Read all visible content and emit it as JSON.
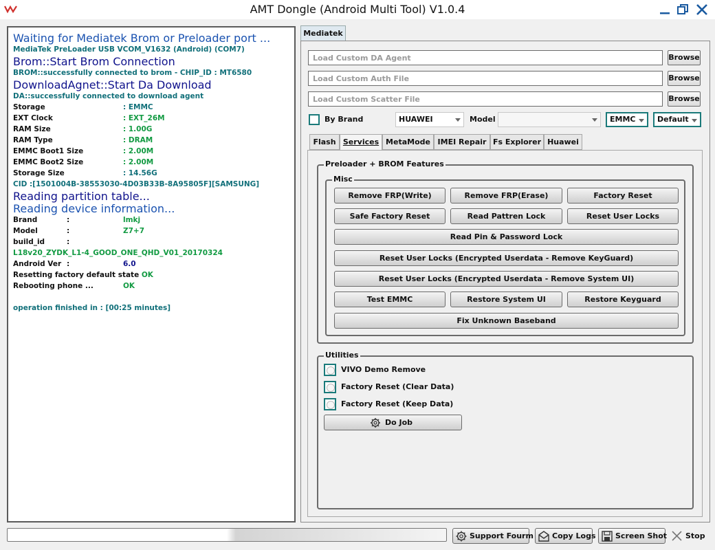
{
  "window": {
    "title": "AMT Dongle (Android Multi Tool) V1.0.4"
  },
  "log": {
    "waiting": "Waiting for Mediatek Brom or Preloader port ...",
    "port": "MediaTek PreLoader USB VCOM_V1632 (Android) (COM7)",
    "brom_start": "Brom::Start Brom Connection",
    "brom_ok": "BROM::successfully connected to brom - CHIP_ID : MT6580",
    "da_start": "DownloadAgnet::Start Da Download",
    "da_ok": "DA::successfully connected to download agent",
    "specs": [
      {
        "key": "Storage",
        "value": ": EMMC"
      },
      {
        "key": "EXT Clock",
        "value": ": EXT_26M"
      },
      {
        "key": "RAM Size",
        "value": ": 1.00G"
      },
      {
        "key": "RAM Type",
        "value": ": DRAM"
      },
      {
        "key": "EMMC Boot1 Size",
        "value": ": 2.00M"
      },
      {
        "key": "EMMC Boot2 Size",
        "value": ": 2.00M"
      },
      {
        "key": "Storage Size",
        "value": ": 14.56G"
      }
    ],
    "cid": "CID :[1501004B-38553030-4D03B33B-8A95805F][SAMSUNG]",
    "reading_partition": "Reading partition table...",
    "reading_device": "Reading device information...",
    "device": {
      "brand_key": "Brand",
      "brand_colon": ":",
      "brand_value": "lmkj",
      "model_key": "Model",
      "model_colon": ":",
      "model_value": "Z7+7",
      "build_key": "build_id",
      "build_colon": ":",
      "build_value": "L18v20_ZYDK_L1-4_GOOD_ONE_QHD_V01_20170324",
      "android_key": "Android Ver",
      "android_colon": ":",
      "android_value": "6.0"
    },
    "reset_label": "Resetting factory default state",
    "reset_status": "OK",
    "reboot_label": "Rebooting phone ...",
    "reboot_status": "OK",
    "finished": "operation finished in : [00:25 minutes]"
  },
  "tabs": {
    "main": "Mediatek"
  },
  "inputs": {
    "da_placeholder": "Load Custom DA Agent",
    "auth_placeholder": "Load Custom Auth File",
    "scatter_placeholder": "Load Custom Scatter File",
    "browse": "Browse"
  },
  "options": {
    "by_brand": "By Brand",
    "brand_value": "HUAWEI",
    "model_label": "Model",
    "model_value": "",
    "storage_value": "EMMC",
    "mode_value": "Default"
  },
  "subtabs": [
    "Flash",
    "Services",
    "MetaMode",
    "IMEI Repair",
    "Fs Explorer",
    "Huawei"
  ],
  "services": {
    "group_title": "Preloader + BROM Features",
    "misc_title": "Misc",
    "buttons": {
      "remove_frp_write": "Remove FRP(Write)",
      "remove_frp_erase": "Remove FRP(Erase)",
      "factory_reset": "Factory Reset",
      "safe_factory_reset": "Safe Factory Reset",
      "read_pattren_lock": "Read Pattren Lock",
      "reset_user_locks": "Reset User Locks",
      "read_pin_password": "Read Pin & Password Lock",
      "reset_keyguard": "Reset User Locks (Encrypted Userdata - Remove KeyGuard)",
      "reset_systemui": "Reset User Locks (Encrypted Userdata - Remove System UI)",
      "test_emmc": "Test EMMC",
      "restore_system_ui": "Restore System UI",
      "restore_keyguard": "Restore Keyguard",
      "fix_baseband": "Fix Unknown Baseband"
    },
    "utilities_title": "Utilities",
    "utilities": [
      "VIVO Demo Remove",
      "Factory Reset (Clear Data)",
      "Factory Reset (Keep Data)"
    ],
    "do_job": "Do Job"
  },
  "bottom": {
    "progress": 0.5,
    "support": "Support Fourm",
    "copy_logs": "Copy Logs",
    "screen_shot": "Screen Shot",
    "stop": "Stop"
  },
  "colors": {
    "accent": "#1a7a7a",
    "log_blue": "#1a52b0",
    "log_green": "#129a42"
  }
}
